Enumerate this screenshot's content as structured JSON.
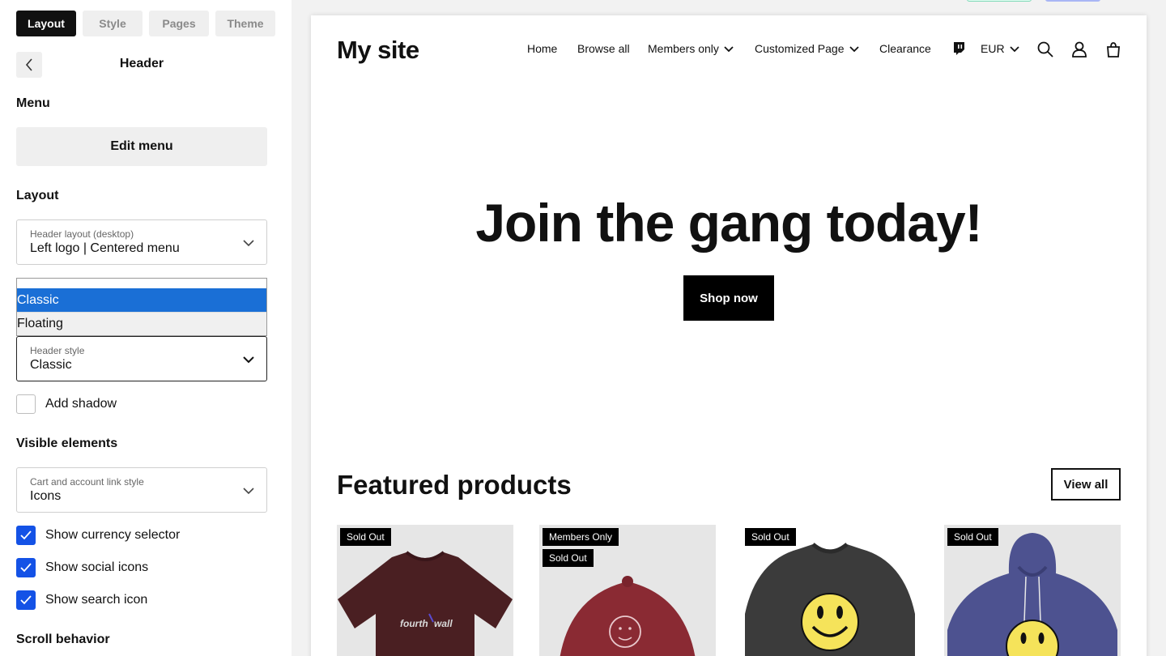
{
  "editor": {
    "tabs": [
      {
        "label": "Layout",
        "active": true
      },
      {
        "label": "Style",
        "active": false
      },
      {
        "label": "Pages",
        "active": false
      },
      {
        "label": "Theme",
        "active": false
      }
    ],
    "title": "Header",
    "menu_section": "Menu",
    "edit_menu_label": "Edit menu",
    "layout_section": "Layout",
    "header_layout": {
      "label": "Header layout (desktop)",
      "value": "Left logo | Centered menu"
    },
    "header_style_options": [
      "Classic",
      "Floating"
    ],
    "header_style": {
      "label": "Header style",
      "value": "Classic"
    },
    "add_shadow": {
      "label": "Add shadow",
      "checked": false
    },
    "visible_section": "Visible elements",
    "cart_style": {
      "label": "Cart and account link style",
      "value": "Icons"
    },
    "checks": [
      {
        "label": "Show currency selector",
        "checked": true
      },
      {
        "label": "Show social icons",
        "checked": true
      },
      {
        "label": "Show search icon",
        "checked": true
      }
    ],
    "scroll_section": "Scroll behavior"
  },
  "site": {
    "logo": "My site",
    "nav": [
      "Home",
      "Browse all",
      "Members only",
      "Customized Page",
      "Clearance"
    ],
    "currency": "EUR",
    "hero_title": "Join the gang today!",
    "hero_button": "Shop now",
    "featured_title": "Featured products",
    "view_all": "View all",
    "products": [
      {
        "badges": [
          "Sold Out"
        ],
        "image": "tshirt-image",
        "color": "#4a1f22"
      },
      {
        "badges": [
          "Members Only",
          "Sold Out"
        ],
        "image": "cap-image",
        "color": "#8a2a33"
      },
      {
        "badges": [
          "Sold Out"
        ],
        "image": "sweatshirt-image",
        "color": "#3d3d3d"
      },
      {
        "badges": [
          "Sold Out"
        ],
        "image": "hoodie-image",
        "color": "#4d5290"
      }
    ],
    "tshirt_print": "fourth wall"
  },
  "colors": {
    "accent": "#1452e6",
    "dropdown_selected": "#1a6fd6"
  }
}
